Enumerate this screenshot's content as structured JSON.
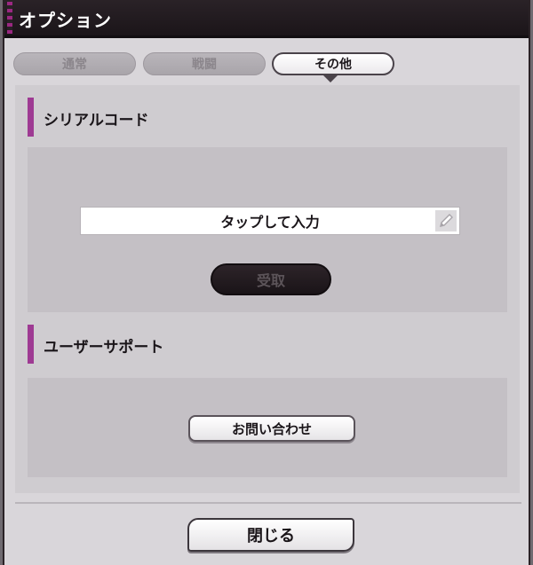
{
  "dialog": {
    "title": "オプション"
  },
  "tabs": [
    {
      "label": "通常",
      "active": false
    },
    {
      "label": "戦闘",
      "active": false
    },
    {
      "label": "その他",
      "active": true
    }
  ],
  "serial": {
    "header": "シリアルコード",
    "input_value": "タップして入力",
    "edit_icon": "pencil-icon",
    "claim_label": "受取"
  },
  "support": {
    "header": "ユーザーサポート",
    "contact_label": "お問い合わせ"
  },
  "footer": {
    "close_label": "閉じる"
  },
  "colors": {
    "accent": "#9e3a93",
    "titlebar": "#1b1519",
    "panel": "#c4c0c5"
  }
}
